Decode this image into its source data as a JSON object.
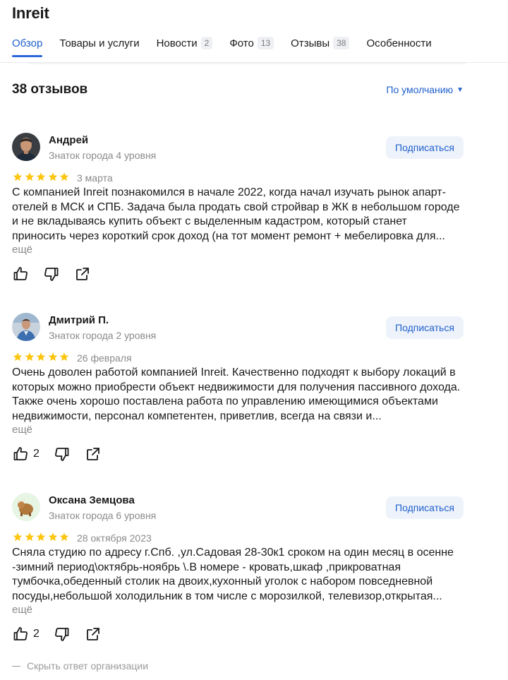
{
  "header": {
    "title": "Inreit"
  },
  "tabs": [
    {
      "label": "Обзор",
      "badge": ""
    },
    {
      "label": "Товары и услуги",
      "badge": ""
    },
    {
      "label": "Новости",
      "badge": "2"
    },
    {
      "label": "Фото",
      "badge": "13"
    },
    {
      "label": "Отзывы",
      "badge": "38"
    },
    {
      "label": "Особенности",
      "badge": ""
    }
  ],
  "reviews_header": {
    "count": "38 отзывов",
    "sort": "По умолчанию"
  },
  "colors": {
    "accent": "#1f5fcc",
    "star": "#fcc50f",
    "subscribe_bg": "#eef3fb"
  },
  "reviews": [
    {
      "author": "Андрей",
      "level": "Знаток города 4 уровня",
      "subscribe": "Подписаться",
      "rating": 5,
      "date": "3 марта",
      "text": "С компанией Inreit познакомился в начале 2022, когда начал изучать рынок апарт-отелей в МСК и СПБ. Задача была продать свой стройвар в ЖК в небольшом городе и не вкладываясь купить объект с выделенным кадастром, который станет приносить через короткий срок доход (на тот момент ремонт + мебелировка для...",
      "more": "ещё",
      "likes": ""
    },
    {
      "author": "Дмитрий П.",
      "level": "Знаток города 2 уровня",
      "subscribe": "Подписаться",
      "rating": 5,
      "date": "26 февраля",
      "text": "Очень доволен работой компанией Inreit. Качественно подходят к выбору локаций в которых можно приобрести объект недвижимости для получения пассивного дохода. Также очень хорошо поставлена работа по управлению имеющимися объектами недвижимости, персонал компетентен, приветлив, всегда на связи и...",
      "more": "ещё",
      "likes": "2"
    },
    {
      "author": "Оксана Земцова",
      "level": "Знаток города 6 уровня",
      "subscribe": "Подписаться",
      "rating": 5,
      "date": "28 октября 2023",
      "text": "Сняла студию по адресу г.Спб. ,ул.Садовая 28-30к1 сроком на один месяц в осенне -зимний период\\октябрь-ноябрь \\.В номере - кровать,шкаф ,прикроватная тумбочка,обеденный столик на двоих,кухонный уголок с набором повседневной посуды,небольшой холодильник в том числе с морозилкой, телевизор,открытая...",
      "more": "ещё",
      "likes": "2"
    }
  ],
  "org_reply": {
    "toggle_label": "Скрыть ответ организации"
  }
}
